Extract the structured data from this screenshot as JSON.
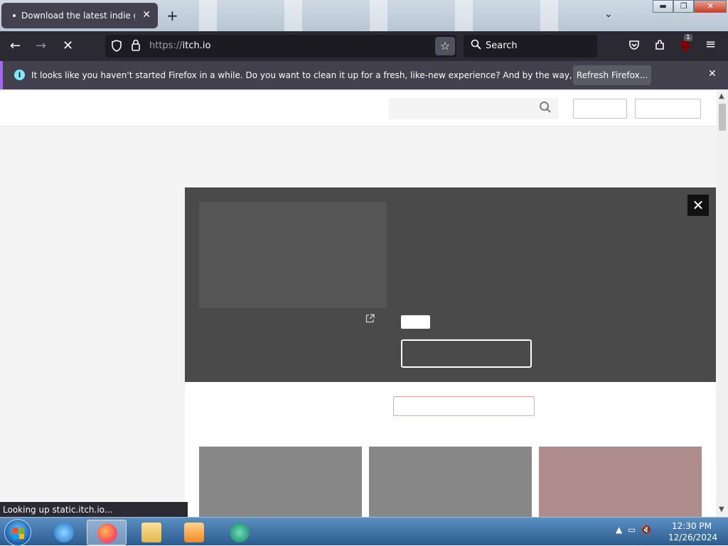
{
  "browser": {
    "tab_title": "Download the latest indie games",
    "tab_close": "✕",
    "new_tab": "+",
    "tab_list": "⌄",
    "window_controls": {
      "minimize": "▬",
      "maximize": "❐",
      "close": "✕"
    },
    "nav": {
      "back": "←",
      "forward": "→",
      "stop": "✕"
    },
    "url_scheme": "https://",
    "url_host": "itch.io",
    "bookmark_star": "☆",
    "search_placeholder": "Search",
    "search_glyph": "⌕",
    "toolbar_icons": [
      "pocket-icon",
      "extensions-icon",
      "ublock-icon",
      "menu-icon"
    ],
    "extension_badge": "1",
    "menu_glyph": "≡"
  },
  "notification": {
    "message": "It looks like you haven't started Firefox in a while. Do you want to clean it up for a fresh, like-new experience? And by the way, welcome back!",
    "button": "Refresh Firefox...",
    "close": "✕",
    "info_glyph": "i"
  },
  "page": {
    "search_icon": "⌕",
    "modal_close": "✕",
    "external_link_glyph": "⇱",
    "card_colors": [
      "#878787",
      "#878787",
      "#ae8c8c"
    ]
  },
  "status_text": "Looking up static.itch.io...",
  "taskbar": {
    "time": "12:30 PM",
    "date": "12/26/2024",
    "apps": [
      "internet-explorer-icon",
      "firefox-icon",
      "file-explorer-icon",
      "media-player-icon",
      "app-icon"
    ],
    "tray_glyph": "▲"
  }
}
